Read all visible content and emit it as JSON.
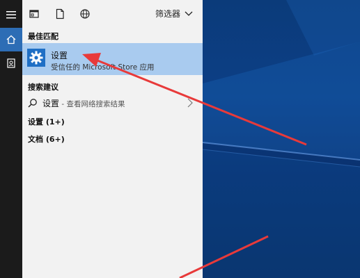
{
  "desktop": {
    "background": "#0b3b7a"
  },
  "rail": {
    "items": [
      {
        "name": "menu",
        "icon": "hamburger-icon"
      },
      {
        "name": "home",
        "icon": "home-icon",
        "active": true
      },
      {
        "name": "notebook",
        "icon": "notebook-icon"
      }
    ],
    "accent": "#2d6db5"
  },
  "topbar": {
    "icons": [
      "apps-icon",
      "document-icon",
      "web-globe-icon"
    ],
    "filters_label": "筛选器"
  },
  "best_match": {
    "heading": "最佳匹配",
    "title": "设置",
    "subtitle": "受信任的 Microsoft Store 应用",
    "highlight": "#a9cbef"
  },
  "search_suggestions": {
    "heading": "搜索建议",
    "item_label": "设置",
    "item_hint": " - 查看网络搜索结果"
  },
  "groups": [
    {
      "label": "设置 (1+)"
    },
    {
      "label": "文档 (6+)"
    }
  ],
  "annotation": {
    "color": "#e83a3a"
  }
}
